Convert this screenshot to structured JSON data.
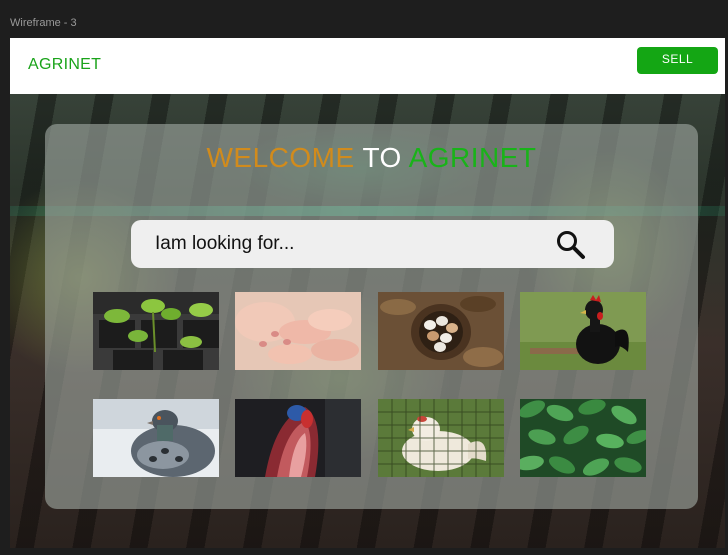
{
  "frame_label": "Wireframe - 3",
  "navbar": {
    "brand": "AGRINET",
    "sell_label": "SELL"
  },
  "hero": {
    "welcome_part1": "WELCOME",
    "welcome_part2": "TO",
    "welcome_part3": "AGRINET",
    "colors": {
      "welcome": "#d18b1c",
      "to": "#ffffff",
      "agrinet": "#19b319",
      "sell": "#14a614"
    }
  },
  "search": {
    "placeholder": "Iam looking for...",
    "value": ""
  },
  "gallery": [
    {
      "name": "seedlings"
    },
    {
      "name": "piglets"
    },
    {
      "name": "eggs-nest"
    },
    {
      "name": "black-rooster"
    },
    {
      "name": "pigeon"
    },
    {
      "name": "turkey"
    },
    {
      "name": "white-hen"
    },
    {
      "name": "green-leaves"
    }
  ]
}
